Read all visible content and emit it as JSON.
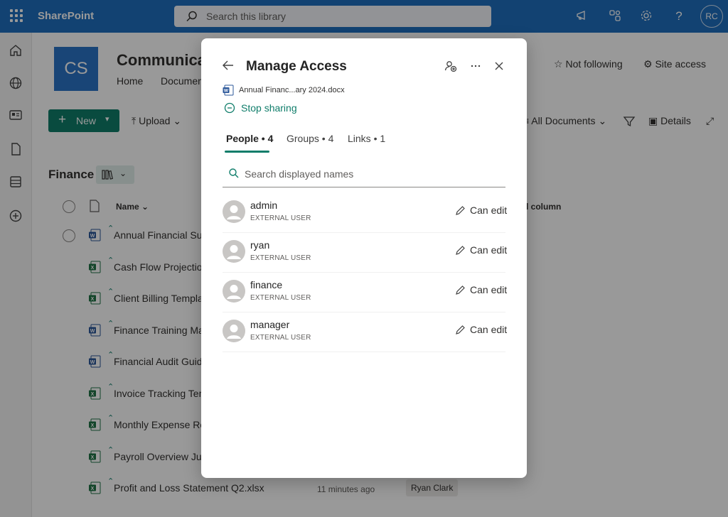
{
  "suite": {
    "app_name": "SharePoint",
    "search_placeholder": "Search this library",
    "user_initials": "RC",
    "icons": [
      "megaphone-icon",
      "connections-icon",
      "gear-icon",
      "help-icon"
    ]
  },
  "site": {
    "logo_initials": "CS",
    "title": "Communica",
    "nav": [
      "Home",
      "Documen"
    ],
    "follow_label": "Not following",
    "site_access_label": "Site access"
  },
  "commands": {
    "new_label": "New",
    "upload_label": "Upload",
    "view_label": "All Documents",
    "details_label": "Details"
  },
  "library": {
    "title": "Finance",
    "col_name": "Name",
    "col_extra": "d column",
    "files": [
      {
        "name": "Annual Financial Sum",
        "type": "word"
      },
      {
        "name": "Cash Flow Projection",
        "type": "excel"
      },
      {
        "name": "Client Billing Templat",
        "type": "excel"
      },
      {
        "name": "Finance Training Man",
        "type": "word"
      },
      {
        "name": "Financial Audit Guide",
        "type": "word"
      },
      {
        "name": "Invoice Tracking Temp",
        "type": "excel"
      },
      {
        "name": "Monthly Expense Rep",
        "type": "excel"
      },
      {
        "name": "Payroll Overview July",
        "type": "excel"
      },
      {
        "name": "Profit and Loss Statement Q2.xlsx",
        "type": "excel",
        "modified": "11 minutes ago",
        "author": "Ryan Clark"
      }
    ]
  },
  "dialog": {
    "title": "Manage Access",
    "file_name": "Annual Financ...ary 2024.docx",
    "stop_sharing": "Stop sharing",
    "tabs": [
      {
        "label": "People • 4",
        "active": true
      },
      {
        "label": "Groups • 4",
        "active": false
      },
      {
        "label": "Links • 1",
        "active": false
      }
    ],
    "search_placeholder": "Search displayed names",
    "people": [
      {
        "name": "admin",
        "type": "EXTERNAL USER",
        "permission": "Can edit"
      },
      {
        "name": "ryan",
        "type": "EXTERNAL USER",
        "permission": "Can edit"
      },
      {
        "name": "finance",
        "type": "EXTERNAL USER",
        "permission": "Can edit"
      },
      {
        "name": "manager",
        "type": "EXTERNAL USER",
        "permission": "Can edit"
      }
    ]
  },
  "colors": {
    "suite_blue": "#1f6fbf",
    "accent_teal": "#0f7d6a",
    "word_blue": "#2b579a",
    "excel_green": "#217346"
  }
}
